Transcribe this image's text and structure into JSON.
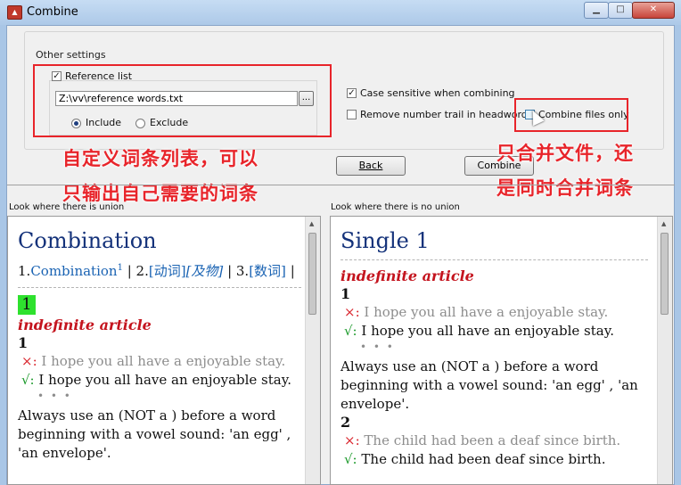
{
  "window": {
    "title": "Combine"
  },
  "settings": {
    "group_label": "Other settings",
    "reference_list": {
      "label": "Reference list",
      "checked": true,
      "path": "Z:\\vv\\reference words.txt",
      "browse_label": "..."
    },
    "include_label": "Include",
    "exclude_label": "Exclude",
    "selected_mode": "Include",
    "case_sensitive": {
      "label": "Case sensitive when combining",
      "checked": true
    },
    "remove_number_trail": {
      "label": "Remove number trail in headword",
      "checked": false
    },
    "combine_files_only": {
      "label": "Combine files only",
      "checked": false
    }
  },
  "buttons": {
    "back": "Back",
    "combine": "Combine"
  },
  "annotations": {
    "left_line_1": "自定义词条列表，可以",
    "left_line_2": "只输出自己需要的词条",
    "right_line_1": "只合并文件，还",
    "right_line_2": "是同时合并词条",
    "color": "#e8242a"
  },
  "left_pane": {
    "caption": "Look where there is union",
    "headword": "Combination",
    "senses": {
      "n1": "1.",
      "s1": "Combination",
      "s1_sup": "1",
      "sep1": " | 2.",
      "s2": "[动词]",
      "s2_it": "[及物]",
      "sep2": " | 3.",
      "s3": "[数词]",
      "tail": " |"
    },
    "badge": "1",
    "pos": "indefinite article",
    "num": "1",
    "wrong": "I hope you all have a enjoyable stay.",
    "right": "I hope you all have an enjoyable stay.",
    "dots": "• • •",
    "note": "Always use an (NOT a ) before a word beginning with a vowel sound: 'an egg' , 'an envelope'."
  },
  "right_pane": {
    "caption": "Look where there is no union",
    "headword": "Single 1",
    "pos": "indefinite article",
    "num1": "1",
    "wrong1": "I hope you all have a enjoyable stay.",
    "right1": "I hope you all have an enjoyable stay.",
    "dots": "• • •",
    "note": "Always use an (NOT a ) before a word beginning with a vowel sound: 'an egg' , 'an envelope'.",
    "num2": "2",
    "wrong2": "The child had been a deaf since birth.",
    "right2": "The child had been deaf since birth."
  },
  "symbols": {
    "cross": "×:",
    "check": "√:"
  }
}
